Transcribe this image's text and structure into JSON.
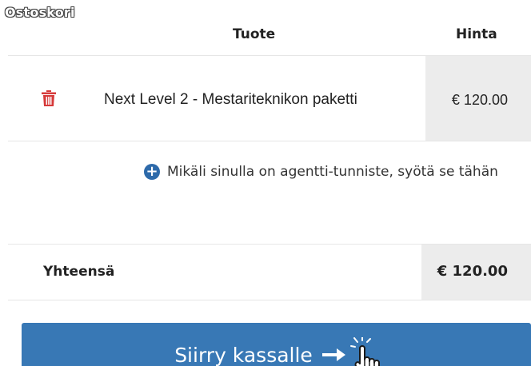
{
  "cart": {
    "label": "Ostoskori"
  },
  "table": {
    "headers": {
      "product": "Tuote",
      "price": "Hinta"
    },
    "rows": [
      {
        "name": "Next Level 2 - Mestariteknikon paketti",
        "price": "€ 120.00"
      }
    ]
  },
  "agent": {
    "text": "Mikäli sinulla on agentti-tunniste, syötä se tähän"
  },
  "total": {
    "label": "Yhteensä",
    "value": "€ 120.00"
  },
  "checkout": {
    "label": "Siirry kassalle"
  },
  "colors": {
    "accent": "#3878b5",
    "delete": "#d63a3a",
    "price_bg": "#ececec"
  },
  "icons": {
    "delete": "trash-icon",
    "add": "plus-circle-icon",
    "arrow": "arrow-right-icon",
    "pointer": "hand-pointer-icon"
  }
}
